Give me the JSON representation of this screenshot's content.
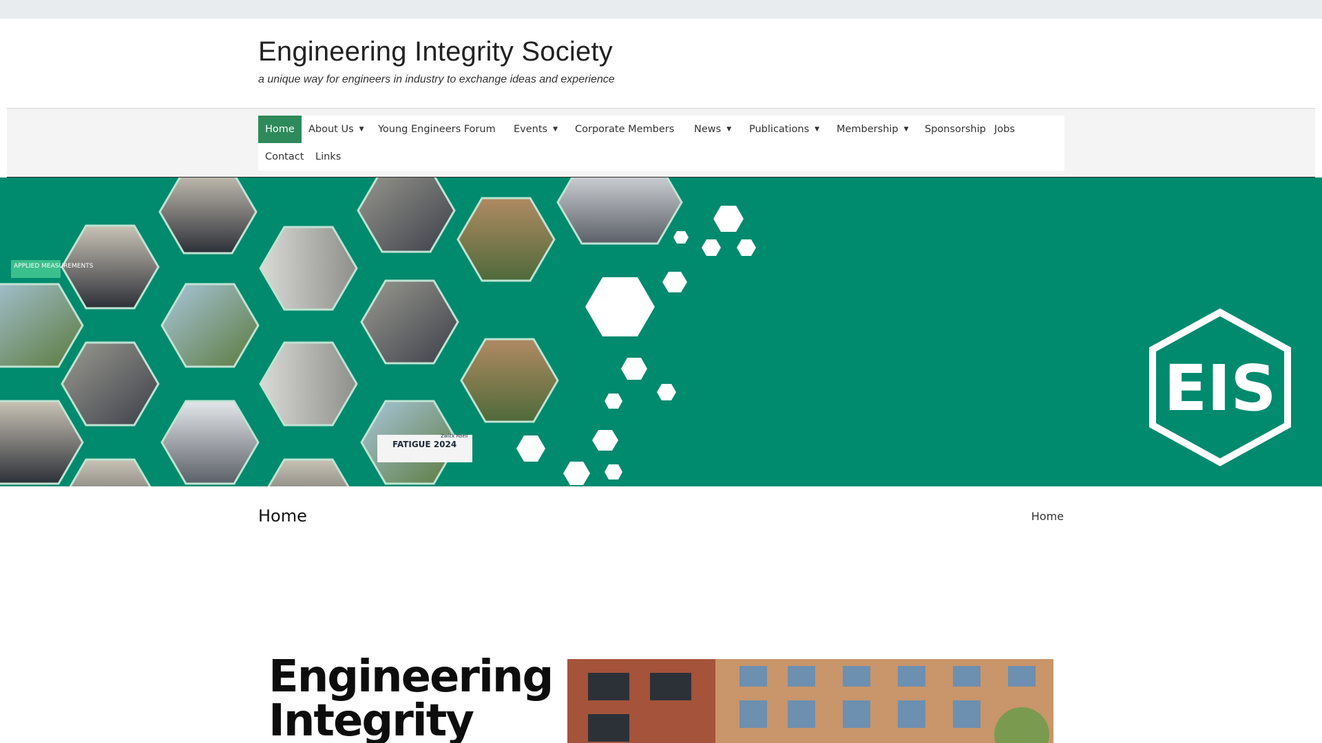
{
  "site": {
    "title": "Engineering Integrity Society",
    "tagline": "a unique way for engineers in industry to exchange ideas and experience"
  },
  "nav": {
    "items": [
      {
        "label": "Home",
        "active": true,
        "has_dropdown": false
      },
      {
        "label": "About Us",
        "active": false,
        "has_dropdown": true
      },
      {
        "label": "Young Engineers Forum",
        "active": false,
        "has_dropdown": false
      },
      {
        "label": "Events",
        "active": false,
        "has_dropdown": true
      },
      {
        "label": "Corporate Members",
        "active": false,
        "has_dropdown": false
      },
      {
        "label": "News",
        "active": false,
        "has_dropdown": true
      },
      {
        "label": "Publications",
        "active": false,
        "has_dropdown": true
      },
      {
        "label": "Membership",
        "active": false,
        "has_dropdown": true
      },
      {
        "label": "Sponsorship",
        "active": false,
        "has_dropdown": false
      },
      {
        "label": "Jobs",
        "active": false,
        "has_dropdown": false
      },
      {
        "label": "Contact",
        "active": false,
        "has_dropdown": false
      },
      {
        "label": "Links",
        "active": false,
        "has_dropdown": false
      }
    ],
    "dropdown_icon": "caret-down-icon"
  },
  "banner": {
    "logo_text": "EIS",
    "photo_captions": [
      "APPLIED MEASUREMENTS",
      "FATIGUE 2024",
      "Zwick Roell"
    ],
    "colors": {
      "background": "#008a6e",
      "hex_border": "#ffffff"
    }
  },
  "page": {
    "title": "Home",
    "breadcrumb": "Home"
  },
  "hero": {
    "heading": "Engineering Integrity"
  },
  "colors": {
    "accent": "#2f8a5b",
    "topbar": "#e8ecee",
    "nav_background": "#f4f4f4"
  }
}
